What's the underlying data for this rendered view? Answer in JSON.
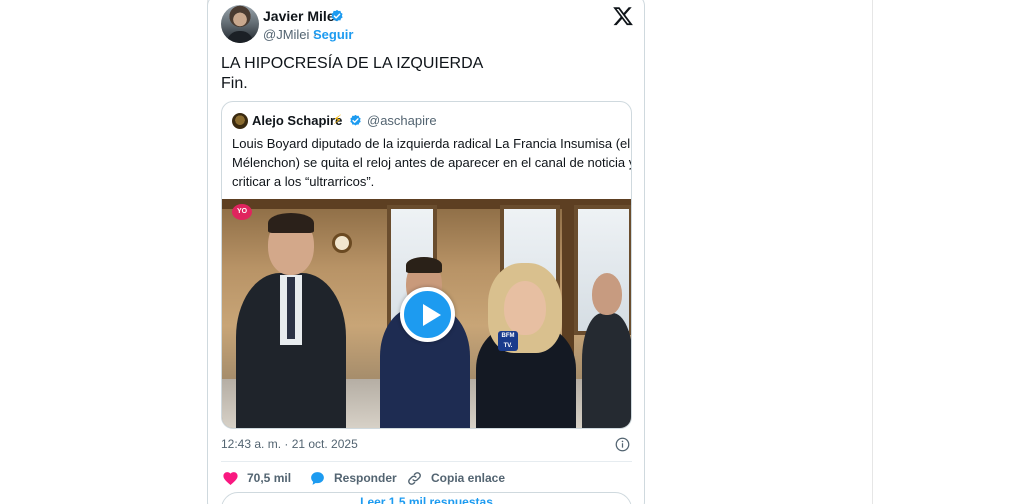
{
  "tweet": {
    "author_name": "Javier Milei",
    "author_handle": "@JMilei",
    "separator": "·",
    "follow_label": "Seguir",
    "text_lines": [
      "LA HIPOCRESÍA DE LA IZQUIERDA",
      "Fin."
    ],
    "timestamp": "12:43 a. m. · 21 oct. 2025"
  },
  "quote": {
    "author_name": "Alejo Schapire",
    "author_emoji": "⚡",
    "author_handle": "@aschapire",
    "text_lines": [
      "Louis Boyard diputado de la izquierda radical La Francia Insumisa (el de",
      "Mélenchon) se quita el reloj antes de aparecer en el canal de noticia y",
      "criticar a los “ultrarricos”."
    ],
    "video": {
      "channel_badge": "YO",
      "mic_label": "BFM TV."
    }
  },
  "actions": {
    "likes_count": "70,5 mil",
    "reply_label": "Responder",
    "copy_label": "Copia enlace",
    "read_replies_label": "Leer 1,5 mil respuestas"
  },
  "colors": {
    "accent": "#1d9bf0",
    "like": "#f91880",
    "text_primary": "#0f1419",
    "text_secondary": "#536471",
    "border": "#cfd9de"
  },
  "icons": {
    "verified": "verified-badge-icon",
    "x_logo": "x-logo-icon",
    "like": "heart-icon",
    "reply": "speech-bubble-icon",
    "copy_link": "link-icon",
    "info": "info-icon",
    "play": "play-icon"
  }
}
